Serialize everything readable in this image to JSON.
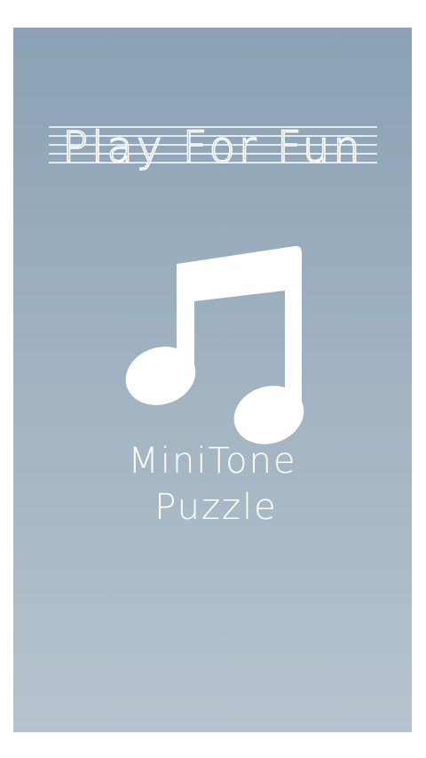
{
  "screen": {
    "tagline": "Play For Fun",
    "title_line1": "MiniTone",
    "title_line2": "Puzzle",
    "icon": "music-note-icon",
    "colors": {
      "background_top": "#8aa2b5",
      "background_bottom": "#b6c3cd",
      "foreground": "#ffffff",
      "frame": "#ffffff"
    }
  }
}
